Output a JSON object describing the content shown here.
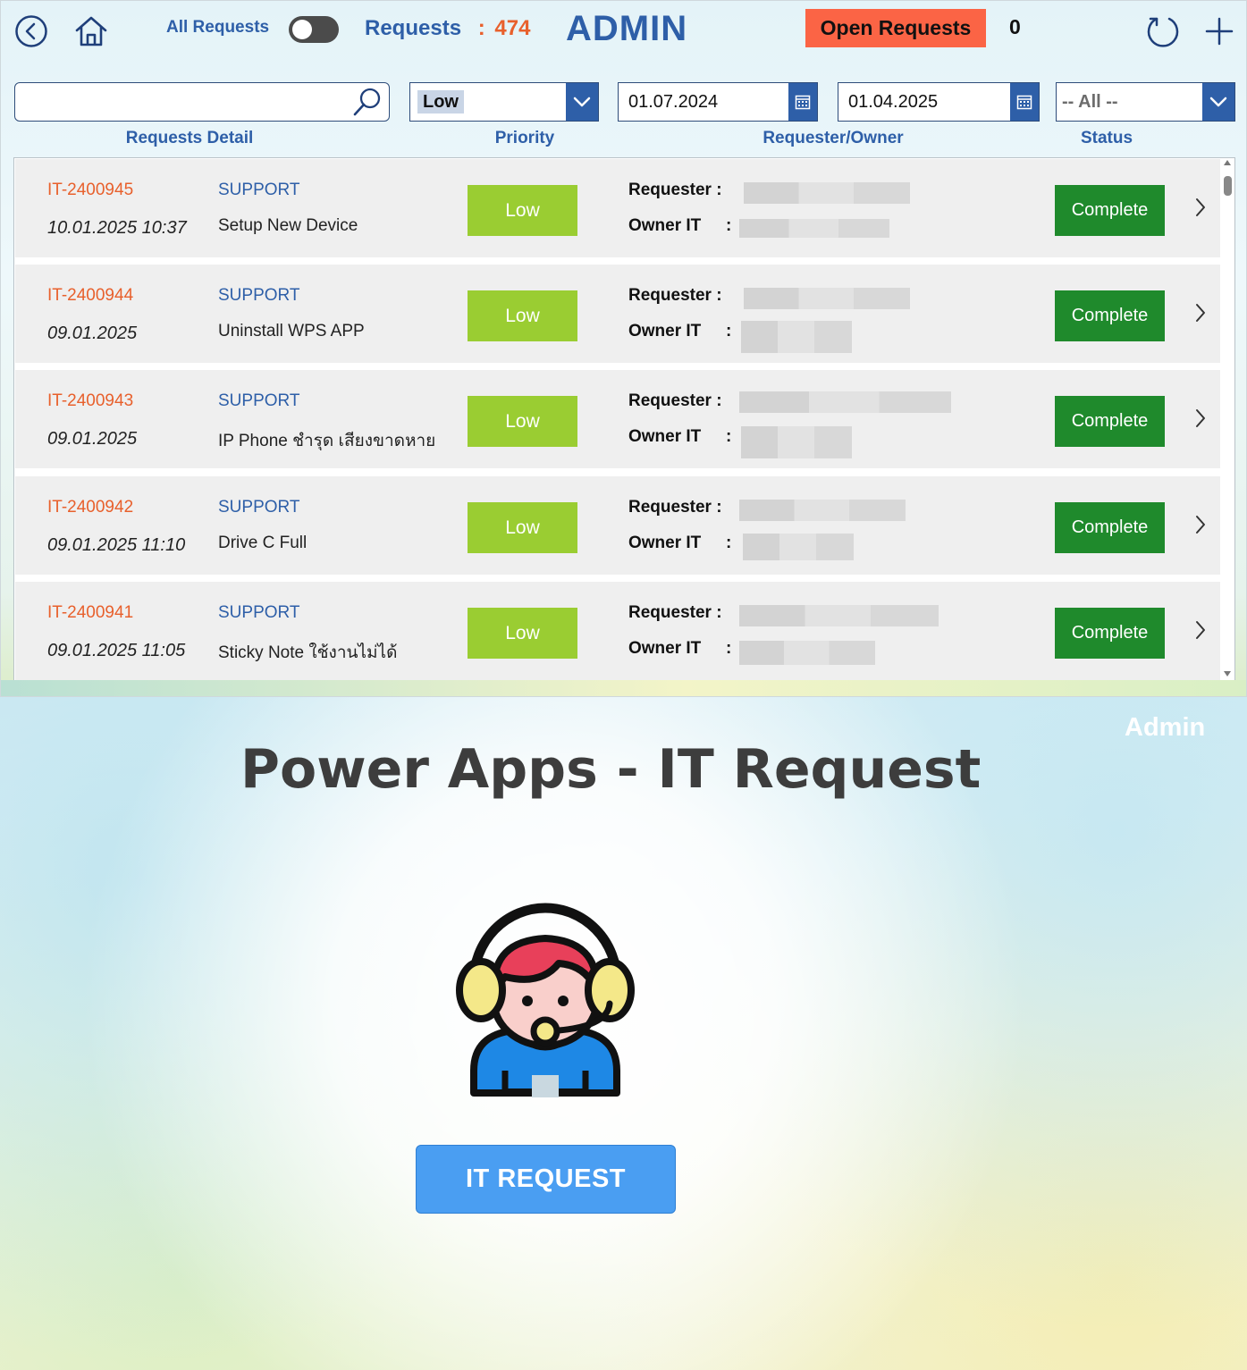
{
  "header": {
    "all_requests_label": "All Requests",
    "requests_label": "Requests",
    "requests_colon": ":",
    "requests_count": "474",
    "title": "ADMIN",
    "open_requests_label": "Open Requests",
    "open_requests_count": "0"
  },
  "filters": {
    "search_value": "",
    "priority_value": "Low",
    "date_from": "01.07.2024",
    "date_to": "01.04.2025",
    "status_value": "-- All --"
  },
  "columns": {
    "detail": "Requests Detail",
    "priority": "Priority",
    "requester_owner": "Requester/Owner",
    "status": "Status"
  },
  "row_labels": {
    "requester": "Requester :",
    "owner": "Owner IT",
    "colon": ":"
  },
  "requests": [
    {
      "id": "IT-2400945",
      "date": "10.01.2025 10:37",
      "category": "SUPPORT",
      "title": "Setup New Device",
      "priority": "Low",
      "status": "Complete"
    },
    {
      "id": "IT-2400944",
      "date": "09.01.2025",
      "category": "SUPPORT",
      "title": "Uninstall WPS APP",
      "priority": "Low",
      "status": "Complete"
    },
    {
      "id": "IT-2400943",
      "date": "09.01.2025",
      "category": "SUPPORT",
      "title": "IP Phone ชำรุด เสียงขาดหาย",
      "priority": "Low",
      "status": "Complete"
    },
    {
      "id": "IT-2400942",
      "date": "09.01.2025 11:10",
      "category": "SUPPORT",
      "title": "Drive C Full",
      "priority": "Low",
      "status": "Complete"
    },
    {
      "id": "IT-2400941",
      "date": "09.01.2025 11:05",
      "category": "SUPPORT",
      "title": "Sticky Note ใช้งานไม่ได้",
      "priority": "Low",
      "status": "Complete"
    }
  ],
  "landing": {
    "admin_label": "Admin",
    "title": "Power Apps - IT Request",
    "button_label": "IT REQUEST"
  },
  "icons": {
    "back": "back-circle-icon",
    "home": "home-icon",
    "refresh": "refresh-icon",
    "add": "plus-icon",
    "search": "search-icon",
    "dropdown": "chevron-down-icon",
    "calendar": "calendar-icon",
    "row_open": "chevron-right-icon",
    "support_agent": "support-agent-icon"
  },
  "colors": {
    "accent_blue": "#2e5fa8",
    "id_orange": "#e8602c",
    "priority_low": "#9acd32",
    "status_complete": "#1f8a2c",
    "open_requests_bg": "#fb6445",
    "landing_button": "#4a9ef2"
  }
}
